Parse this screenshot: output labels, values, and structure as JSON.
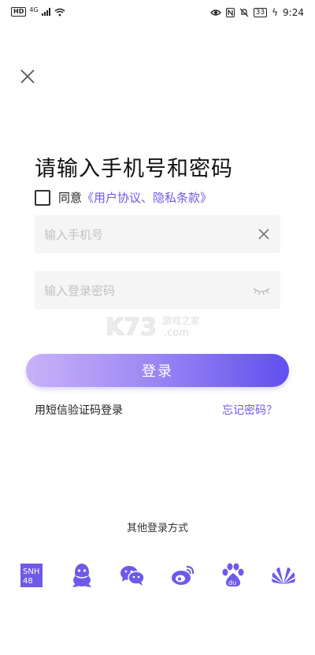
{
  "status_bar": {
    "hd": "HD",
    "network": "4G",
    "battery": "33",
    "time": "9:24"
  },
  "login": {
    "title": "请输入手机号和密码",
    "agree_prefix": "同意",
    "agree_link": "《用户协议、隐私条款》",
    "phone_placeholder": "输入手机号",
    "password_placeholder": "输入登录密码",
    "login_button": "登录",
    "sms_login": "用短信验证码登录",
    "forgot_password": "忘记密码？",
    "other_methods": "其他登录方式"
  },
  "watermark": {
    "brand": "K73",
    "text": "游戏之家",
    "domain": ".com"
  },
  "social_logins": [
    {
      "icon": "snh48-icon",
      "label": "SNH 48"
    },
    {
      "icon": "qq-icon"
    },
    {
      "icon": "wechat-icon"
    },
    {
      "icon": "weibo-icon"
    },
    {
      "icon": "baidu-icon",
      "label": "du"
    },
    {
      "icon": "huawei-icon"
    }
  ],
  "colors": {
    "accent": "#6d5ae8",
    "gradient_start": "#c9b2f8",
    "gradient_end": "#6050ee",
    "field_bg": "#f5f5f5"
  }
}
